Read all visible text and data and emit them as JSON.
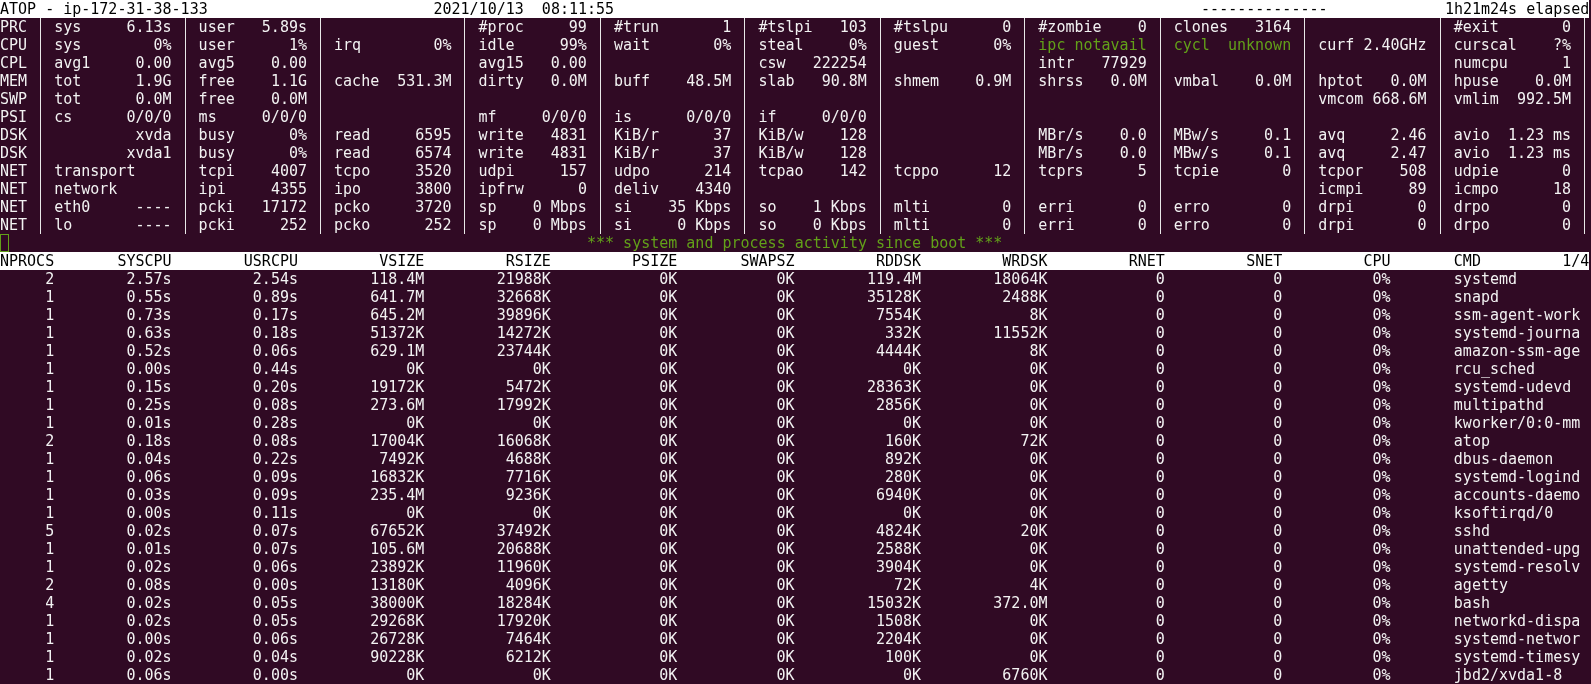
{
  "header": {
    "title": "ATOP - ip-172-31-38-133",
    "timestamp": "2021/10/13  08:11:55",
    "separator": "--------------",
    "elapsed": "1h21m24s elapsed"
  },
  "system_rows": [
    {
      "label": "PRC",
      "cells": [
        {
          "key": "sys",
          "value": "6.13s"
        },
        {
          "key": "user",
          "value": "5.89s"
        },
        null,
        {
          "key": "#proc",
          "value": "99"
        },
        {
          "key": "#trun",
          "value": "1"
        },
        {
          "key": "#tslpi",
          "value": "103"
        },
        {
          "key": "#tslpu",
          "value": "0"
        },
        {
          "key": "#zombie",
          "value": "0"
        },
        {
          "key": "clones",
          "value": "3164"
        },
        null,
        {
          "key": "#exit",
          "value": "0"
        }
      ]
    },
    {
      "label": "CPU",
      "cells": [
        {
          "key": "sys",
          "value": "0%"
        },
        {
          "key": "user",
          "value": "1%"
        },
        {
          "key": "irq",
          "value": "0%"
        },
        {
          "key": "idle",
          "value": "99%"
        },
        {
          "key": "wait",
          "value": "0%"
        },
        {
          "key": "steal",
          "value": "0%"
        },
        {
          "key": "guest",
          "value": "0%"
        },
        {
          "key": "ipc",
          "value": "notavail",
          "color": "#62a019"
        },
        {
          "key": "cycl",
          "value": "unknown",
          "color": "#62a019"
        },
        {
          "key": "curf",
          "value": "2.40GHz"
        },
        {
          "key": "curscal",
          "value": "?%"
        }
      ]
    },
    {
      "label": "CPL",
      "cells": [
        {
          "key": "avg1",
          "value": "0.00"
        },
        {
          "key": "avg5",
          "value": "0.00"
        },
        null,
        {
          "key": "avg15",
          "value": "0.00"
        },
        null,
        {
          "key": "csw",
          "value": "222254"
        },
        null,
        {
          "key": "intr",
          "value": "77929"
        },
        null,
        null,
        {
          "key": "numcpu",
          "value": "1"
        }
      ]
    },
    {
      "label": "MEM",
      "cells": [
        {
          "key": "tot",
          "value": "1.9G"
        },
        {
          "key": "free",
          "value": "1.1G"
        },
        {
          "key": "cache",
          "value": "531.3M"
        },
        {
          "key": "dirty",
          "value": "0.0M"
        },
        {
          "key": "buff",
          "value": "48.5M"
        },
        {
          "key": "slab",
          "value": "90.8M"
        },
        {
          "key": "shmem",
          "value": "0.9M"
        },
        {
          "key": "shrss",
          "value": "0.0M"
        },
        {
          "key": "vmbal",
          "value": "0.0M"
        },
        {
          "key": "hptot",
          "value": "0.0M"
        },
        {
          "key": "hpuse",
          "value": "0.0M"
        }
      ]
    },
    {
      "label": "SWP",
      "cells": [
        {
          "key": "tot",
          "value": "0.0M"
        },
        {
          "key": "free",
          "value": "0.0M"
        },
        null,
        null,
        null,
        null,
        null,
        null,
        null,
        {
          "key": "vmcom",
          "value": "668.6M"
        },
        {
          "key": "vmlim",
          "value": "992.5M"
        }
      ]
    },
    {
      "label": "PSI",
      "cells": [
        {
          "key": "cs",
          "value": "0/0/0"
        },
        {
          "key": "ms",
          "value": "0/0/0"
        },
        null,
        {
          "key": "mf",
          "value": "0/0/0"
        },
        {
          "key": "is",
          "value": "0/0/0"
        },
        {
          "key": "if",
          "value": "0/0/0"
        },
        null,
        null,
        null,
        null,
        null
      ]
    },
    {
      "label": "DSK",
      "cells": [
        {
          "value": "xvda"
        },
        {
          "key": "busy",
          "value": "0%"
        },
        {
          "key": "read",
          "value": "6595"
        },
        {
          "key": "write",
          "value": "4831"
        },
        {
          "key": "KiB/r",
          "value": "37"
        },
        {
          "key": "KiB/w",
          "value": "128"
        },
        null,
        {
          "key": "MBr/s",
          "value": "0.0"
        },
        {
          "key": "MBw/s",
          "value": "0.1"
        },
        {
          "key": "avq",
          "value": "2.46"
        },
        {
          "key": "avio",
          "value": "1.23 ms"
        }
      ]
    },
    {
      "label": "DSK",
      "cells": [
        {
          "value": "xvda1"
        },
        {
          "key": "busy",
          "value": "0%"
        },
        {
          "key": "read",
          "value": "6574"
        },
        {
          "key": "write",
          "value": "4831"
        },
        {
          "key": "KiB/r",
          "value": "37"
        },
        {
          "key": "KiB/w",
          "value": "128"
        },
        null,
        {
          "key": "MBr/s",
          "value": "0.0"
        },
        {
          "key": "MBw/s",
          "value": "0.1"
        },
        {
          "key": "avq",
          "value": "2.47"
        },
        {
          "key": "avio",
          "value": "1.23 ms"
        }
      ]
    },
    {
      "label": "NET",
      "cells": [
        {
          "key": "transport"
        },
        {
          "key": "tcpi",
          "value": "4007"
        },
        {
          "key": "tcpo",
          "value": "3520"
        },
        {
          "key": "udpi",
          "value": "157"
        },
        {
          "key": "udpo",
          "value": "214"
        },
        {
          "key": "tcpao",
          "value": "142"
        },
        {
          "key": "tcppo",
          "value": "12"
        },
        {
          "key": "tcprs",
          "value": "5"
        },
        {
          "key": "tcpie",
          "value": "0"
        },
        {
          "key": "tcpor",
          "value": "508"
        },
        {
          "key": "udpie",
          "value": "0"
        }
      ]
    },
    {
      "label": "NET",
      "cells": [
        {
          "key": "network"
        },
        {
          "key": "ipi",
          "value": "4355"
        },
        {
          "key": "ipo",
          "value": "3800"
        },
        {
          "key": "ipfrw",
          "value": "0"
        },
        {
          "key": "deliv",
          "value": "4340"
        },
        null,
        null,
        null,
        null,
        {
          "key": "icmpi",
          "value": "89"
        },
        {
          "key": "icmpo",
          "value": "18"
        }
      ]
    },
    {
      "label": "NET",
      "cells": [
        {
          "key": "eth0",
          "value": "----"
        },
        {
          "key": "pcki",
          "value": "17172"
        },
        {
          "key": "pcko",
          "value": "3720"
        },
        {
          "key": "sp",
          "value": "0 Mbps"
        },
        {
          "key": "si",
          "value": "35 Kbps"
        },
        {
          "key": "so",
          "value": "1 Kbps"
        },
        {
          "key": "mlti",
          "value": "0"
        },
        {
          "key": "erri",
          "value": "0"
        },
        {
          "key": "erro",
          "value": "0"
        },
        {
          "key": "drpi",
          "value": "0"
        },
        {
          "key": "drpo",
          "value": "0"
        }
      ]
    },
    {
      "label": "NET",
      "cells": [
        {
          "key": "lo",
          "value": "----"
        },
        {
          "key": "pcki",
          "value": "252"
        },
        {
          "key": "pcko",
          "value": "252"
        },
        {
          "key": "sp",
          "value": "0 Mbps"
        },
        {
          "key": "si",
          "value": "0 Kbps"
        },
        {
          "key": "so",
          "value": "0 Kbps"
        },
        {
          "key": "mlti",
          "value": "0"
        },
        {
          "key": "erri",
          "value": "0"
        },
        {
          "key": "erro",
          "value": "0"
        },
        {
          "key": "drpi",
          "value": "0"
        },
        {
          "key": "drpo",
          "value": "0"
        }
      ]
    }
  ],
  "banner": "*** system and process activity since boot ***",
  "process_table": {
    "columns": [
      "NPROCS",
      "SYSCPU",
      "USRCPU",
      "VSIZE",
      "RSIZE",
      "PSIZE",
      "SWAPSZ",
      "RDDSK",
      "WRDSK",
      "RNET",
      "SNET",
      "CPU",
      "CMD"
    ],
    "page": "1/4",
    "rows": [
      [
        "2",
        "2.57s",
        "2.54s",
        "118.4M",
        "21988K",
        "0K",
        "0K",
        "119.4M",
        "18064K",
        "0",
        "0",
        "0%",
        "systemd"
      ],
      [
        "1",
        "0.55s",
        "0.89s",
        "641.7M",
        "32668K",
        "0K",
        "0K",
        "35128K",
        "2488K",
        "0",
        "0",
        "0%",
        "snapd"
      ],
      [
        "1",
        "0.73s",
        "0.17s",
        "645.2M",
        "39896K",
        "0K",
        "0K",
        "7554K",
        "8K",
        "0",
        "0",
        "0%",
        "ssm-agent-work"
      ],
      [
        "1",
        "0.63s",
        "0.18s",
        "51372K",
        "14272K",
        "0K",
        "0K",
        "332K",
        "11552K",
        "0",
        "0",
        "0%",
        "systemd-journa"
      ],
      [
        "1",
        "0.52s",
        "0.06s",
        "629.1M",
        "23744K",
        "0K",
        "0K",
        "4444K",
        "8K",
        "0",
        "0",
        "0%",
        "amazon-ssm-age"
      ],
      [
        "1",
        "0.00s",
        "0.44s",
        "0K",
        "0K",
        "0K",
        "0K",
        "0K",
        "0K",
        "0",
        "0",
        "0%",
        "rcu_sched"
      ],
      [
        "1",
        "0.15s",
        "0.20s",
        "19172K",
        "5472K",
        "0K",
        "0K",
        "28363K",
        "0K",
        "0",
        "0",
        "0%",
        "systemd-udevd"
      ],
      [
        "1",
        "0.25s",
        "0.08s",
        "273.6M",
        "17992K",
        "0K",
        "0K",
        "2856K",
        "0K",
        "0",
        "0",
        "0%",
        "multipathd"
      ],
      [
        "1",
        "0.01s",
        "0.28s",
        "0K",
        "0K",
        "0K",
        "0K",
        "0K",
        "0K",
        "0",
        "0",
        "0%",
        "kworker/0:0-mm"
      ],
      [
        "2",
        "0.18s",
        "0.08s",
        "17004K",
        "16068K",
        "0K",
        "0K",
        "160K",
        "72K",
        "0",
        "0",
        "0%",
        "atop"
      ],
      [
        "1",
        "0.04s",
        "0.22s",
        "7492K",
        "4688K",
        "0K",
        "0K",
        "892K",
        "0K",
        "0",
        "0",
        "0%",
        "dbus-daemon"
      ],
      [
        "1",
        "0.06s",
        "0.09s",
        "16832K",
        "7716K",
        "0K",
        "0K",
        "280K",
        "0K",
        "0",
        "0",
        "0%",
        "systemd-logind"
      ],
      [
        "1",
        "0.03s",
        "0.09s",
        "235.4M",
        "9236K",
        "0K",
        "0K",
        "6940K",
        "0K",
        "0",
        "0",
        "0%",
        "accounts-daemo"
      ],
      [
        "1",
        "0.00s",
        "0.11s",
        "0K",
        "0K",
        "0K",
        "0K",
        "0K",
        "0K",
        "0",
        "0",
        "0%",
        "ksoftirqd/0"
      ],
      [
        "5",
        "0.02s",
        "0.07s",
        "67652K",
        "37492K",
        "0K",
        "0K",
        "4824K",
        "20K",
        "0",
        "0",
        "0%",
        "sshd"
      ],
      [
        "1",
        "0.01s",
        "0.07s",
        "105.6M",
        "20688K",
        "0K",
        "0K",
        "2588K",
        "0K",
        "0",
        "0",
        "0%",
        "unattended-upg"
      ],
      [
        "1",
        "0.02s",
        "0.06s",
        "23892K",
        "11960K",
        "0K",
        "0K",
        "3904K",
        "0K",
        "0",
        "0",
        "0%",
        "systemd-resolv"
      ],
      [
        "2",
        "0.08s",
        "0.00s",
        "13180K",
        "4096K",
        "0K",
        "0K",
        "72K",
        "4K",
        "0",
        "0",
        "0%",
        "agetty"
      ],
      [
        "4",
        "0.02s",
        "0.05s",
        "38000K",
        "18284K",
        "0K",
        "0K",
        "15032K",
        "372.0M",
        "0",
        "0",
        "0%",
        "bash"
      ],
      [
        "1",
        "0.02s",
        "0.05s",
        "29268K",
        "17920K",
        "0K",
        "0K",
        "1508K",
        "0K",
        "0",
        "0",
        "0%",
        "networkd-dispa"
      ],
      [
        "1",
        "0.00s",
        "0.06s",
        "26728K",
        "7464K",
        "0K",
        "0K",
        "2204K",
        "0K",
        "0",
        "0",
        "0%",
        "systemd-networ"
      ],
      [
        "1",
        "0.02s",
        "0.04s",
        "90228K",
        "6212K",
        "0K",
        "0K",
        "100K",
        "0K",
        "0",
        "0",
        "0%",
        "systemd-timesy"
      ],
      [
        "1",
        "0.06s",
        "0.00s",
        "0K",
        "0K",
        "0K",
        "0K",
        "0K",
        "6760K",
        "0",
        "0",
        "0%",
        "jbd2/xvda1-8"
      ]
    ]
  }
}
